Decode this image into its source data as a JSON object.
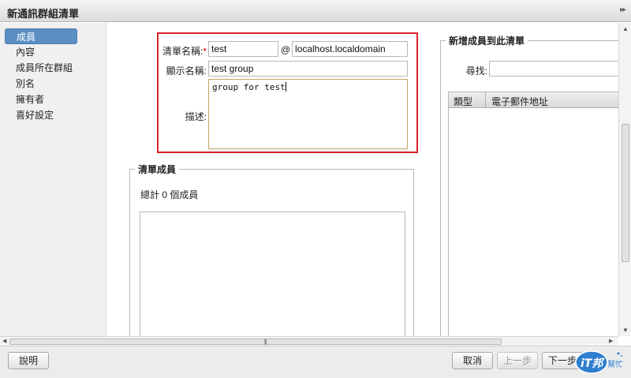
{
  "window": {
    "title": "新通訊群組清單",
    "collapse_glyph": "▸▸"
  },
  "sidebar": {
    "items": [
      {
        "label": "成員",
        "active": true
      },
      {
        "label": "內容",
        "active": false
      },
      {
        "label": "成員所在群組",
        "active": false
      },
      {
        "label": "別名",
        "active": false
      },
      {
        "label": "擁有者",
        "active": false
      },
      {
        "label": "喜好設定",
        "active": false
      }
    ]
  },
  "form": {
    "list_name_label": "清單名稱:",
    "required_mark": "*",
    "list_name_value": "test",
    "at_sign": "@",
    "domain_value": "localhost.localdomain",
    "display_name_label": "顯示名稱:",
    "display_name_value": "test group",
    "description_label": "描述:",
    "description_value": "group for test"
  },
  "members_panel": {
    "legend": "清單成員",
    "total_text": "總計 0 個成員"
  },
  "add_panel": {
    "legend": "新增成員到此清單",
    "search_label": "尋找:",
    "search_value": "",
    "columns": [
      "類型",
      "電子郵件地址"
    ]
  },
  "footer": {
    "help": "說明",
    "cancel": "取消",
    "prev": "上一步",
    "next": "下一步"
  },
  "watermark": {
    "text": "iT邦",
    "sub": "幫忙"
  },
  "colors": {
    "highlight_border": "#d9232a",
    "active_item": "#5b8fc4",
    "textarea_border": "#c7a46a"
  }
}
